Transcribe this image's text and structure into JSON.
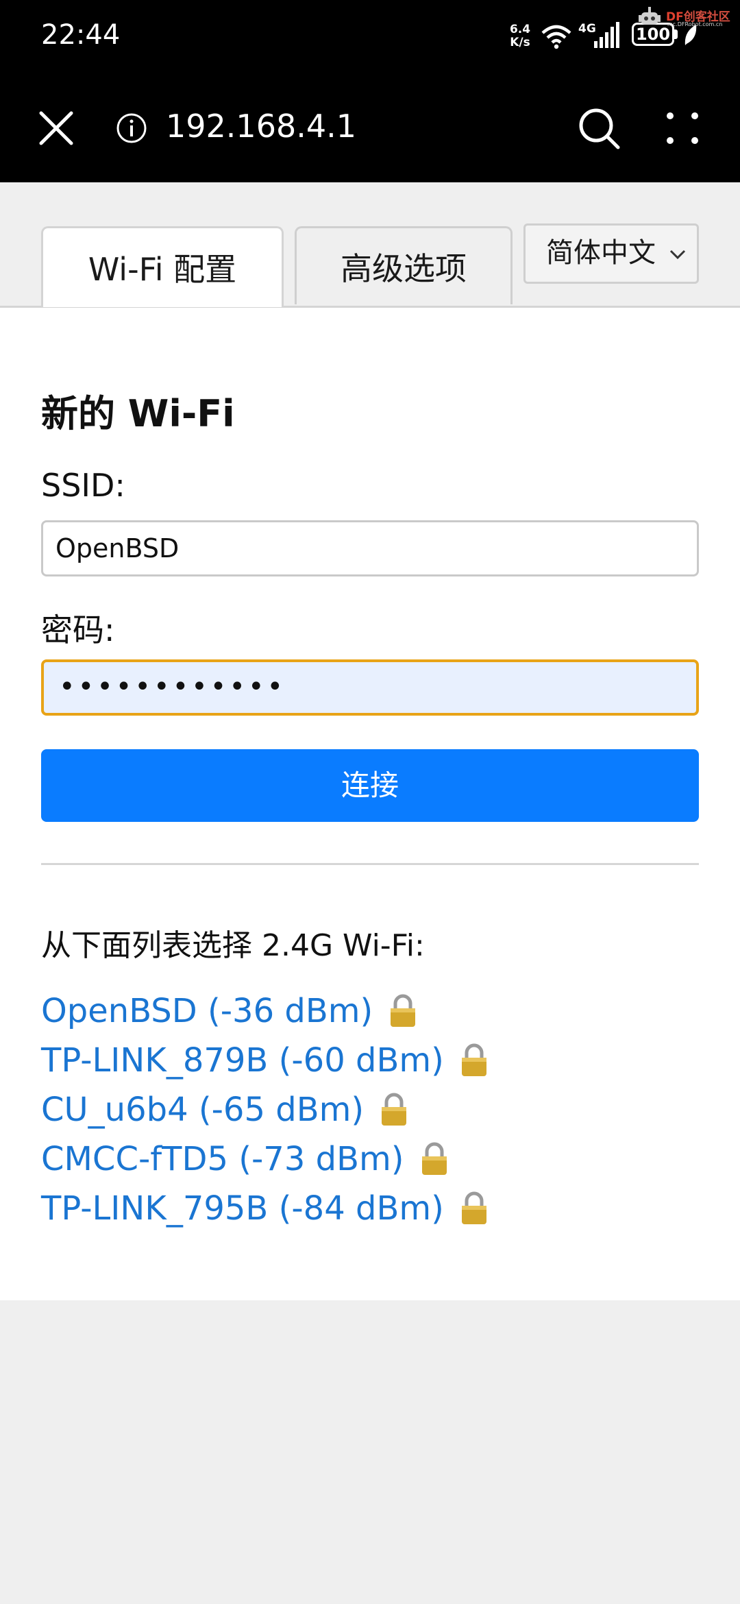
{
  "status_bar": {
    "time": "22:44",
    "speed_value": "6.4",
    "speed_unit": "K/s",
    "network": "4G",
    "battery": "100",
    "watermark_brand": "DF",
    "watermark_name": "创客社区",
    "watermark_domain": "mc.DFRobot.com.cn"
  },
  "browser": {
    "url": "192.168.4.1"
  },
  "tabs": {
    "wifi_config": "Wi-Fi 配置",
    "advanced": "高级选项",
    "language": "简体中文"
  },
  "form": {
    "title": "新的 Wi-Fi",
    "ssid_label": "SSID:",
    "ssid_value": "OpenBSD",
    "password_label": "密码:",
    "password_value": "••••••••••••",
    "connect_label": "连接"
  },
  "network_list": {
    "label": "从下面列表选择 2.4G Wi-Fi:",
    "items": [
      {
        "name": "OpenBSD (-36 dBm)"
      },
      {
        "name": "TP-LINK_879B (-60 dBm)"
      },
      {
        "name": "CU_u6b4 (-65 dBm)"
      },
      {
        "name": "CMCC-fTD5 (-73 dBm)"
      },
      {
        "name": "TP-LINK_795B (-84 dBm)"
      }
    ]
  },
  "colors": {
    "accent": "#0a7cff",
    "link": "#1a75d2",
    "focus_border": "#e8a317",
    "autofill_bg": "#e8f0fe"
  },
  "icons": [
    "close-icon",
    "info-icon",
    "search-icon",
    "more-vertical-icon",
    "chevron-down-icon",
    "lock-icon",
    "wifi-icon",
    "signal-icon",
    "battery-icon"
  ]
}
